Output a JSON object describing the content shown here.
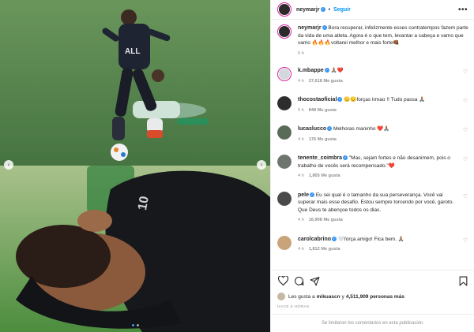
{
  "post": {
    "author": "neymarjr",
    "follow_label": "Seguir",
    "more_label": "•••",
    "caption": "Bora recuperar, infelizmente esses contratempos fazem parte da vida de uma atleta. Agora é o que tem, levantar a cabeça e vamo que vamo 🔥🔥🔥voltarei melhor e mais forte👊🏾",
    "caption_time": "5 h",
    "shirt_text": "ALL",
    "nav_prev": "‹",
    "nav_next": "›"
  },
  "comments": [
    {
      "user": "k.mbappe",
      "text": "🙏🏽❤️",
      "time": "4 h",
      "likes": "27,618 Me gusta",
      "reply": "",
      "avatar_color": "#d4d8dc"
    },
    {
      "user": "thocostaoficial",
      "text": "😔😔forças Irmao !! Tudo passa 🙏🏽",
      "time": "5 h",
      "likes": "848 Me gusta",
      "reply": "",
      "avatar_color": "#2d2d2d"
    },
    {
      "user": "lucaslucco",
      "text": "Melhoras maninho ❤️🙏🏽",
      "time": "4 h",
      "likes": "176 Me gusta",
      "reply": "",
      "avatar_color": "#5a6b58"
    },
    {
      "user": "tenente_coimbra",
      "text": "\"Mas, sejam fortes e não desanimem, pois o trabalho de vocês será recompensado.\"❤️",
      "time": "4 h",
      "likes": "1,805 Me gusta",
      "reply": "",
      "avatar_color": "#6e746e"
    },
    {
      "user": "pele",
      "text": "Eu sei qual é o tamanho da sua perseverança. Você vai superar mais esse desafio. Estou sempre torcendo por você, garoto. Que Deus te abençoe todos os dias.",
      "time": "4 h",
      "likes": "16,908 Me gusta",
      "reply": "",
      "avatar_color": "#4a4a4a"
    },
    {
      "user": "carolcabrino",
      "text": "🤍força amigo! Fica bem. 🙏🏽",
      "time": "4 h",
      "likes": "1,812 Me gusta",
      "reply": "Responder",
      "avatar_color": "#c9a37a"
    }
  ],
  "actions": {
    "liked_by": "Les gusta a ",
    "liked_user": "mikuascn",
    "liked_and": " y ",
    "liked_count": "4,511,909 personas más",
    "time_ago": "HACE 5 HORAS",
    "comments_limited": "Se limitaron los comentarios en esta publicación."
  },
  "icons": {
    "like": "heart-icon",
    "comment": "comment-icon",
    "share": "share-icon",
    "save": "bookmark-icon"
  },
  "colors": {
    "link_blue": "#0095f6",
    "verified_blue": "#3897f0",
    "muted": "#8e8e8e",
    "text": "#262626",
    "pitch_green": "#4f7d4a"
  }
}
